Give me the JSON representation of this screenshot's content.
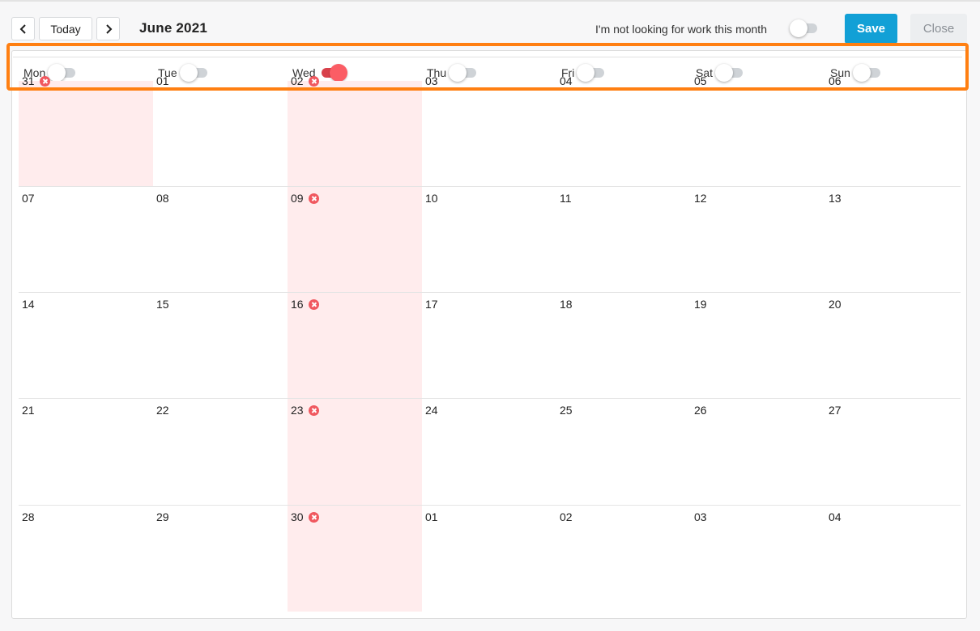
{
  "toolbar": {
    "prev_icon": "chevron-left-icon",
    "today_label": "Today",
    "next_icon": "chevron-right-icon",
    "month_title": "June 2021",
    "not_looking_label": "I'm not looking for work this month",
    "not_looking_on": false,
    "save_label": "Save",
    "close_label": "Close"
  },
  "colors": {
    "save": "#12a0d6",
    "highlight_box": "#ff7f11",
    "toggle_on": "#fb5d65",
    "unavailable_shade": "#ffeced",
    "unavailable_icon": "#f0585f"
  },
  "weekdays": [
    {
      "label": "Mon",
      "on": false
    },
    {
      "label": "Tue",
      "on": false
    },
    {
      "label": "Wed",
      "on": true
    },
    {
      "label": "Thu",
      "on": false
    },
    {
      "label": "Fri",
      "on": false
    },
    {
      "label": "Sat",
      "on": false
    },
    {
      "label": "Sun",
      "on": false
    }
  ],
  "weeks": [
    [
      {
        "day": "31",
        "unavailable": true
      },
      {
        "day": "01",
        "unavailable": false
      },
      {
        "day": "02",
        "unavailable": true
      },
      {
        "day": "03",
        "unavailable": false
      },
      {
        "day": "04",
        "unavailable": false
      },
      {
        "day": "05",
        "unavailable": false
      },
      {
        "day": "06",
        "unavailable": false
      }
    ],
    [
      {
        "day": "07",
        "unavailable": false
      },
      {
        "day": "08",
        "unavailable": false
      },
      {
        "day": "09",
        "unavailable": true
      },
      {
        "day": "10",
        "unavailable": false
      },
      {
        "day": "11",
        "unavailable": false
      },
      {
        "day": "12",
        "unavailable": false
      },
      {
        "day": "13",
        "unavailable": false
      }
    ],
    [
      {
        "day": "14",
        "unavailable": false
      },
      {
        "day": "15",
        "unavailable": false
      },
      {
        "day": "16",
        "unavailable": true
      },
      {
        "day": "17",
        "unavailable": false
      },
      {
        "day": "18",
        "unavailable": false
      },
      {
        "day": "19",
        "unavailable": false
      },
      {
        "day": "20",
        "unavailable": false
      }
    ],
    [
      {
        "day": "21",
        "unavailable": false
      },
      {
        "day": "22",
        "unavailable": false
      },
      {
        "day": "23",
        "unavailable": true
      },
      {
        "day": "24",
        "unavailable": false
      },
      {
        "day": "25",
        "unavailable": false
      },
      {
        "day": "26",
        "unavailable": false
      },
      {
        "day": "27",
        "unavailable": false
      }
    ],
    [
      {
        "day": "28",
        "unavailable": false
      },
      {
        "day": "29",
        "unavailable": false
      },
      {
        "day": "30",
        "unavailable": true
      },
      {
        "day": "01",
        "unavailable": false
      },
      {
        "day": "02",
        "unavailable": false
      },
      {
        "day": "03",
        "unavailable": false
      },
      {
        "day": "04",
        "unavailable": false
      }
    ]
  ]
}
